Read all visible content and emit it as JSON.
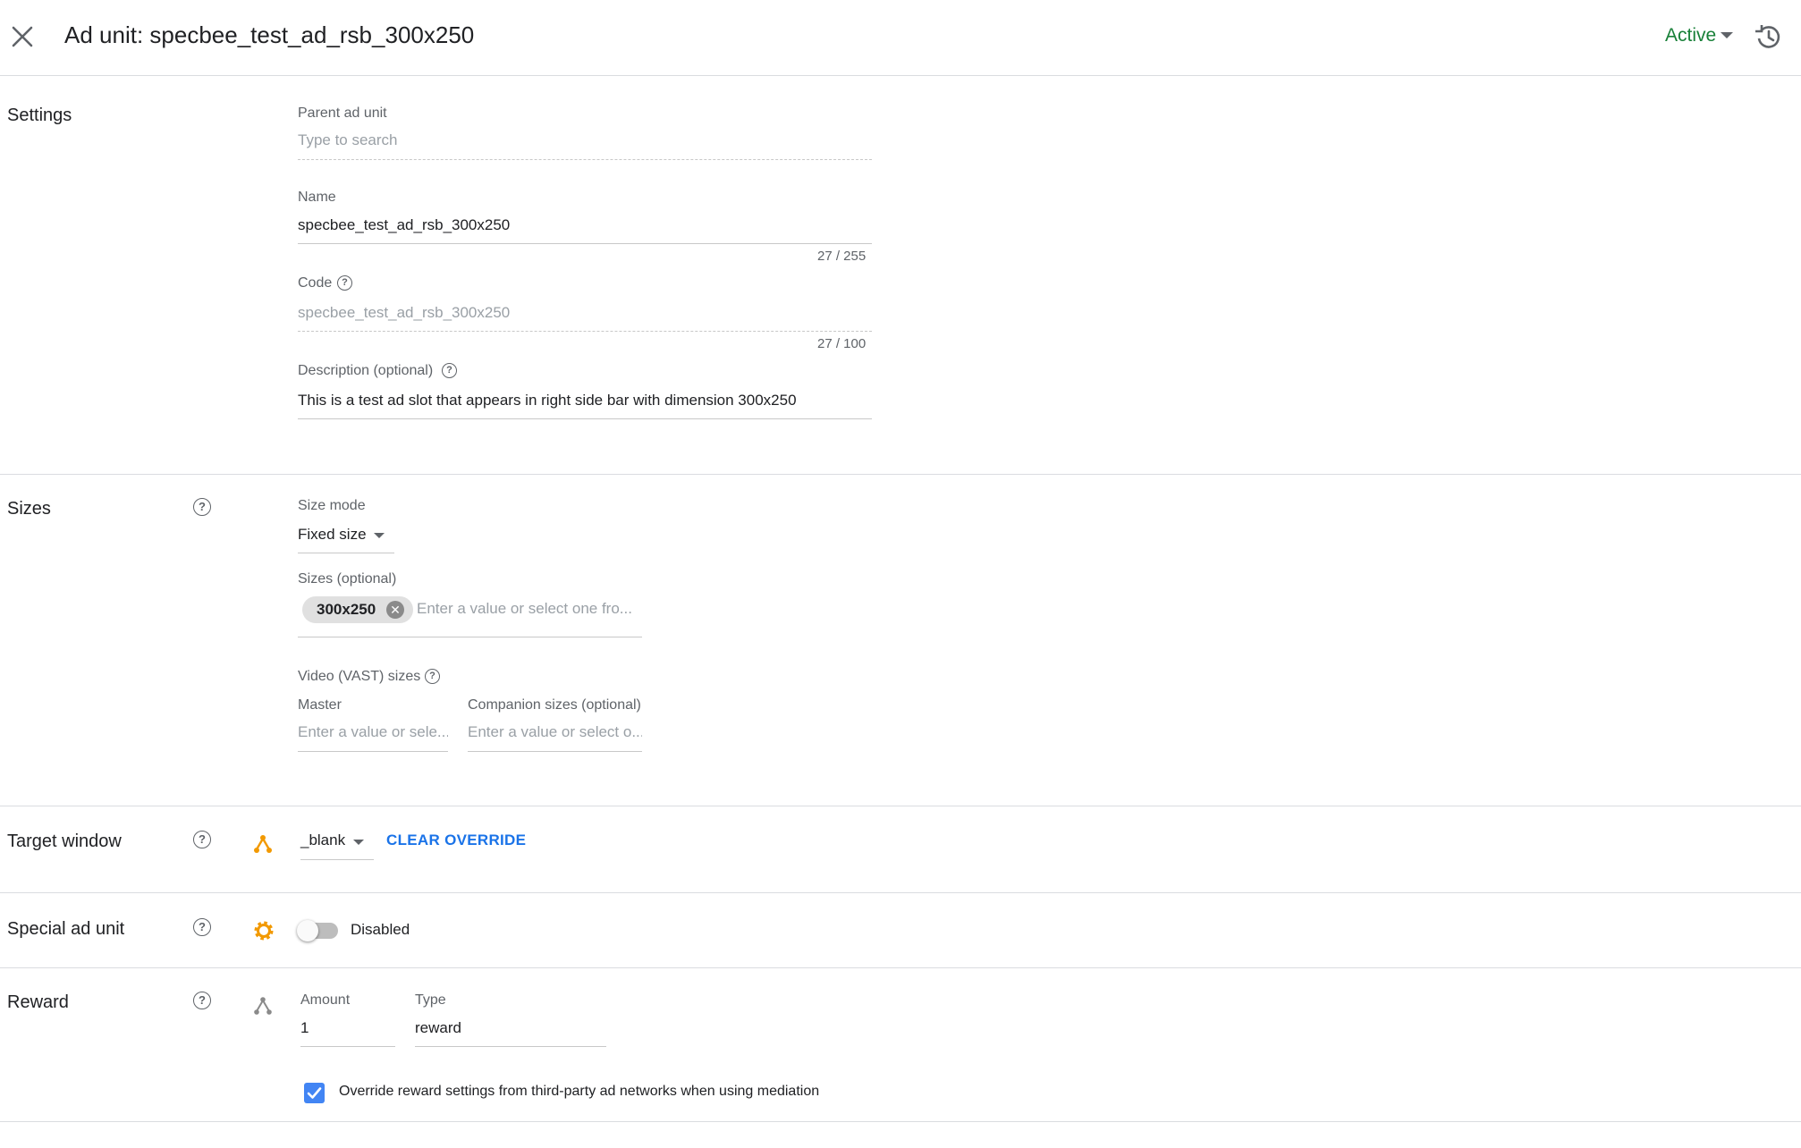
{
  "header": {
    "title": "Ad unit: specbee_test_ad_rsb_300x250",
    "status": "Active",
    "icons": [
      "close-icon",
      "chevron-down-icon",
      "history-icon"
    ]
  },
  "settings": {
    "title": "Settings",
    "parent": {
      "label": "Parent ad unit",
      "placeholder": "Type to search"
    },
    "name": {
      "label": "Name",
      "value": "specbee_test_ad_rsb_300x250",
      "counter": "27 / 255"
    },
    "code": {
      "label": "Code",
      "value": "specbee_test_ad_rsb_300x250",
      "counter": "27 / 100"
    },
    "description": {
      "label": "Description (optional)",
      "value": "This is a test ad slot that appears in right side bar with dimension 300x250"
    }
  },
  "sizes": {
    "title": "Sizes",
    "size_mode": {
      "label": "Size mode",
      "value": "Fixed size"
    },
    "sizes_field": {
      "label": "Sizes (optional)",
      "chip": "300x250",
      "placeholder": "Enter a value or select one fro..."
    },
    "video": {
      "label": "Video (VAST) sizes",
      "master": {
        "label": "Master",
        "placeholder": "Enter a value or sele..."
      },
      "companion": {
        "label": "Companion sizes (optional)",
        "placeholder": "Enter a value or select o..."
      }
    }
  },
  "target_window": {
    "title": "Target window",
    "icon": "inheritance-icon",
    "value": "_blank",
    "clear_label": "CLEAR OVERRIDE"
  },
  "special_ad_unit": {
    "title": "Special ad unit",
    "icon": "gear-icon",
    "toggle_on": false,
    "toggle_label": "Disabled"
  },
  "reward": {
    "title": "Reward",
    "icon": "inheritance-icon",
    "amount": {
      "label": "Amount",
      "value": "1"
    },
    "type": {
      "label": "Type",
      "value": "reward"
    },
    "override": {
      "checked": true,
      "label": "Override reward settings from third-party ad networks when using mediation"
    }
  },
  "colors": {
    "active_green": "#188038",
    "link_blue": "#1a73e8",
    "icon_orange": "#f29900",
    "checkbox_blue": "#4285f4"
  }
}
